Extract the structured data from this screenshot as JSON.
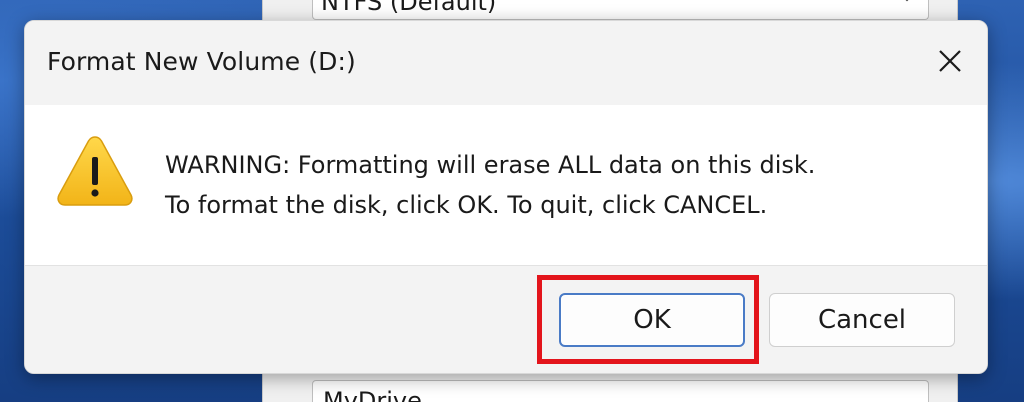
{
  "background": {
    "parent_dialog": {
      "filesystem_value": "NTFS (Default)",
      "volume_label_value": "MyDrive"
    }
  },
  "dialog": {
    "title": "Format New Volume (D:)",
    "close_icon": "close-icon",
    "warning_icon": "warning-icon",
    "message_line1": "WARNING: Formatting will erase ALL data on this disk.",
    "message_line2": "To format the disk, click OK. To quit, click CANCEL.",
    "ok_label": "OK",
    "cancel_label": "Cancel"
  },
  "annotation": {
    "highlight_color": "#e3141b",
    "highlight_target": "ok-button"
  },
  "colors": {
    "warning_yellow": "#f7c325",
    "ok_border": "#4a7bc6"
  }
}
